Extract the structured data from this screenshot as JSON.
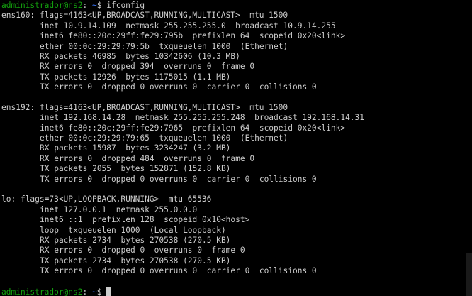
{
  "prompt": {
    "user_host": "administrador@ns2",
    "sep": ":",
    "path": " ~",
    "symbol": "$",
    "command": " ifconfig"
  },
  "interfaces": [
    {
      "header": "ens160: flags=4163<UP,BROADCAST,RUNNING,MULTICAST>  mtu 1500",
      "lines": [
        "inet 10.9.14.109  netmask 255.255.255.0  broadcast 10.9.14.255",
        "inet6 fe80::20c:29ff:fe29:795b  prefixlen 64  scopeid 0x20<link>",
        "ether 00:0c:29:29:79:5b  txqueuelen 1000  (Ethernet)",
        "RX packets 46985  bytes 10342606 (10.3 MB)",
        "RX errors 0  dropped 394  overruns 0  frame 0",
        "TX packets 12926  bytes 1175015 (1.1 MB)",
        "TX errors 0  dropped 0 overruns 0  carrier 0  collisions 0"
      ]
    },
    {
      "header": "ens192: flags=4163<UP,BROADCAST,RUNNING,MULTICAST>  mtu 1500",
      "lines": [
        "inet 192.168.14.28  netmask 255.255.255.248  broadcast 192.168.14.31",
        "inet6 fe80::20c:29ff:fe29:7965  prefixlen 64  scopeid 0x20<link>",
        "ether 00:0c:29:29:79:65  txqueuelen 1000  (Ethernet)",
        "RX packets 15987  bytes 3234247 (3.2 MB)",
        "RX errors 0  dropped 484  overruns 0  frame 0",
        "TX packets 2055  bytes 152871 (152.8 KB)",
        "TX errors 0  dropped 0 overruns 0  carrier 0  collisions 0"
      ]
    },
    {
      "header": "lo: flags=73<UP,LOOPBACK,RUNNING>  mtu 65536",
      "lines": [
        "inet 127.0.0.1  netmask 255.0.0.0",
        "inet6 ::1  prefixlen 128  scopeid 0x10<host>",
        "loop  txqueuelen 1000  (Local Loopback)",
        "RX packets 2734  bytes 270538 (270.5 KB)",
        "RX errors 0  dropped 0  overruns 0  frame 0",
        "TX packets 2734  bytes 270538 (270.5 KB)",
        "TX errors 0  dropped 0 overruns 0  carrier 0  collisions 0"
      ]
    }
  ],
  "colors": {
    "background": "#000000",
    "text": "#cccccc",
    "user_host": "#13a10e",
    "path": "#3b78ff"
  }
}
